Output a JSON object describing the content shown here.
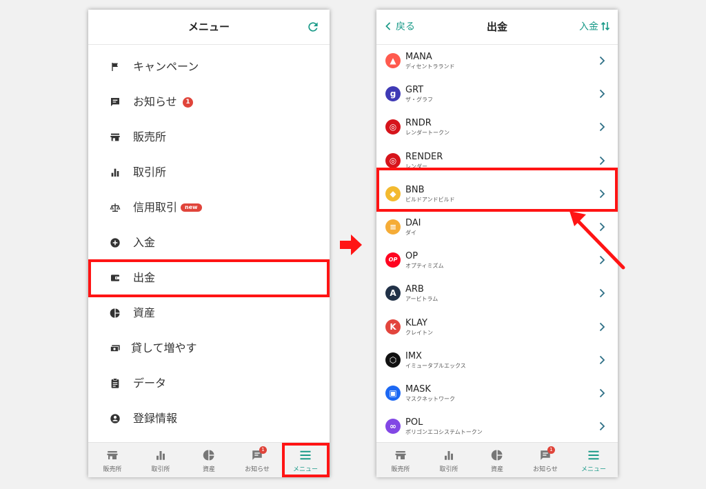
{
  "left_screen": {
    "title": "メニュー",
    "menu": [
      {
        "label": "キャンペーン",
        "icon": "flag-icon"
      },
      {
        "label": "お知らせ",
        "icon": "message-icon",
        "badge": "1"
      },
      {
        "label": "販売所",
        "icon": "store-icon"
      },
      {
        "label": "取引所",
        "icon": "bar-chart-icon"
      },
      {
        "label": "信用取引",
        "icon": "scale-icon",
        "badge": "new"
      },
      {
        "label": "入金",
        "icon": "plus-circle-icon"
      },
      {
        "label": "出金",
        "icon": "wallet-icon"
      },
      {
        "label": "資産",
        "icon": "pie-chart-icon"
      },
      {
        "label": "貸して増やす",
        "icon": "cash-icon"
      },
      {
        "label": "データ",
        "icon": "clipboard-icon"
      },
      {
        "label": "登録情報",
        "icon": "account-icon"
      }
    ]
  },
  "right_screen": {
    "title": "出金",
    "back_label": "戻る",
    "deposit_label": "入金",
    "coins": [
      {
        "symbol": "MANA",
        "name": "ディセントラランド",
        "color": "#ff5a4e"
      },
      {
        "symbol": "GRT",
        "name": "ザ・グラフ",
        "color": "#3f3ab5"
      },
      {
        "symbol": "RNDR",
        "name": "レンダートークン",
        "color": "#d6141b"
      },
      {
        "symbol": "RENDER",
        "name": "レンダー",
        "color": "#d6141b"
      },
      {
        "symbol": "BNB",
        "name": "ビルドアンドビルド",
        "color": "#f3ba2f"
      },
      {
        "symbol": "DAI",
        "name": "ダイ",
        "color": "#f5ac37"
      },
      {
        "symbol": "OP",
        "name": "オプティミズム",
        "color": "#ff0420"
      },
      {
        "symbol": "ARB",
        "name": "アービトラム",
        "color": "#213147"
      },
      {
        "symbol": "KLAY",
        "name": "クレイトン",
        "color": "#e2453d"
      },
      {
        "symbol": "IMX",
        "name": "イミュータブルエックス",
        "color": "#111111"
      },
      {
        "symbol": "MASK",
        "name": "マスクネットワーク",
        "color": "#1c68f3"
      },
      {
        "symbol": "POL",
        "name": "ポリゴンエコシステムトークン",
        "color": "#8247e5"
      }
    ]
  },
  "tabbar": [
    {
      "label": "販売所",
      "icon": "store-icon"
    },
    {
      "label": "取引所",
      "icon": "bar-chart-icon"
    },
    {
      "label": "資産",
      "icon": "pie-chart-icon"
    },
    {
      "label": "お知らせ",
      "icon": "message-icon",
      "badge": "1"
    },
    {
      "label": "メニュー",
      "icon": "hamburger-icon",
      "active": true
    }
  ],
  "colors": {
    "accent": "#1a9a88",
    "highlight": "#ff1414",
    "badge": "#e0443a"
  }
}
